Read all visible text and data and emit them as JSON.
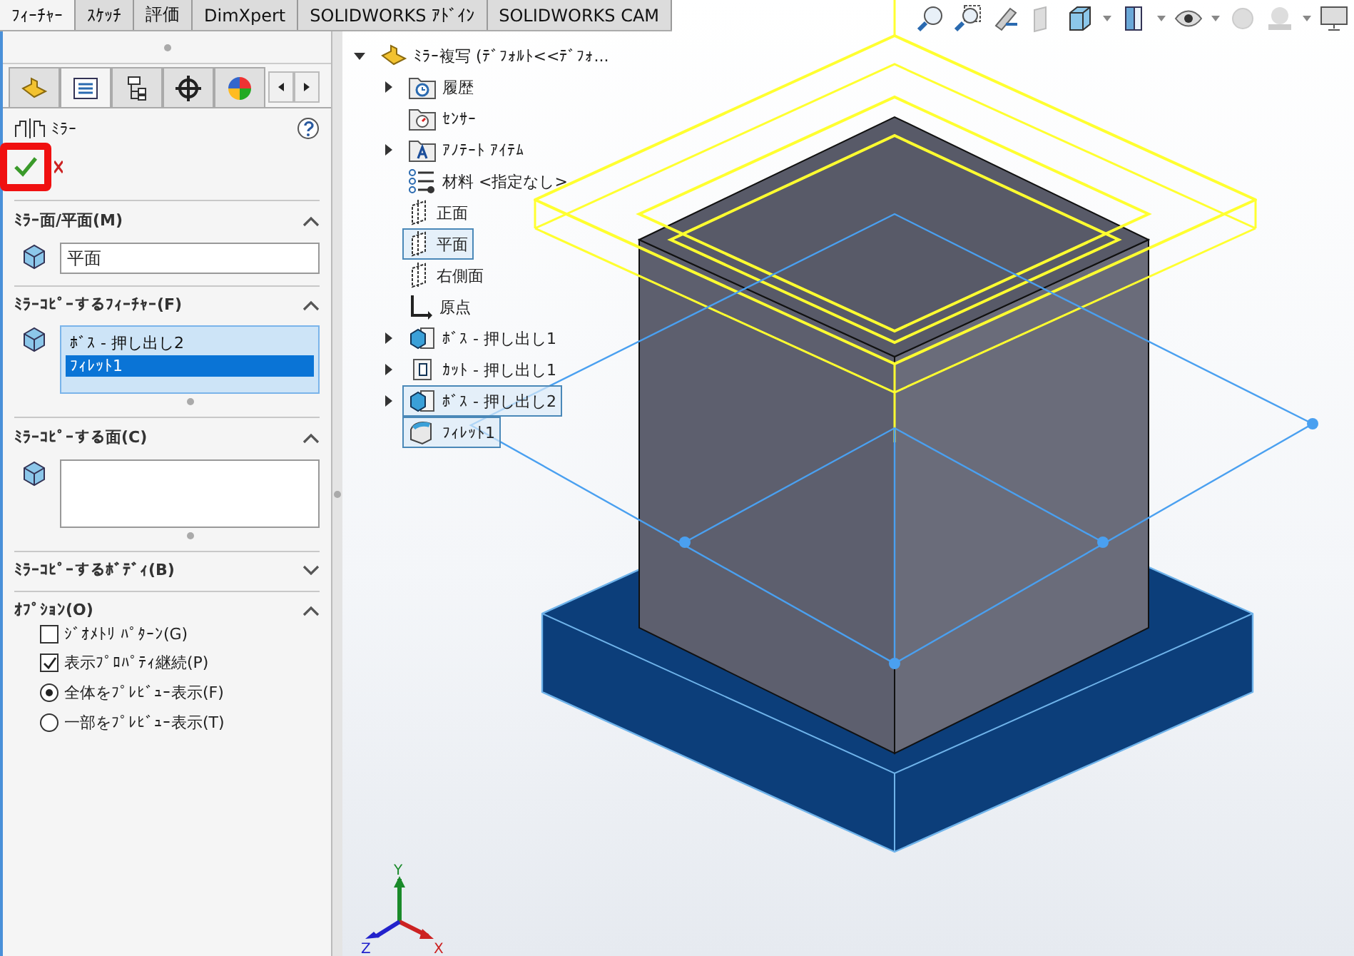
{
  "command_tabs": [
    {
      "label": "ﾌｨｰﾁｬｰ",
      "selected": true
    },
    {
      "label": "ｽｹｯﾁ",
      "selected": false
    },
    {
      "label": "評価",
      "selected": false
    },
    {
      "label": "DimXpert",
      "selected": false
    },
    {
      "label": "SOLIDWORKS ｱﾄﾞｲﾝ",
      "selected": false
    },
    {
      "label": "SOLIDWORKS CAM",
      "selected": false
    }
  ],
  "panel": {
    "tabs": [
      {
        "kind": "part",
        "selected": false
      },
      {
        "kind": "property",
        "selected": true
      },
      {
        "kind": "config",
        "selected": false
      },
      {
        "kind": "target",
        "selected": false
      },
      {
        "kind": "appearance",
        "selected": false
      }
    ],
    "title": "ﾐﾗｰ",
    "ok_highlighted": true,
    "sections": [
      {
        "kind": "field",
        "title": "ﾐﾗｰ面/平面(M)",
        "expanded": true,
        "value": "平面"
      },
      {
        "kind": "list",
        "title": "ﾐﾗｰｺﾋﾟｰするﾌｨｰﾁｬｰ(F)",
        "expanded": true,
        "items": [
          {
            "label": "ﾎﾞｽ - 押し出し2",
            "selected": false
          },
          {
            "label": "ﾌｨﾚｯﾄ1",
            "selected": true
          }
        ]
      },
      {
        "kind": "list",
        "title": "ﾐﾗｰｺﾋﾟｰする面(C)",
        "expanded": true
      },
      {
        "title": "ﾐﾗｰｺﾋﾟｰするﾎﾞﾃﾞｨ(B)",
        "expanded": false
      },
      {
        "kind": "options",
        "title": "ｵﾌﾟｼｮﾝ(O)",
        "expanded": true,
        "options": [
          {
            "kind": "checkbox",
            "label": "ｼﾞｵﾒﾄﾘ ﾊﾟﾀｰﾝ(G)",
            "checked": false
          },
          {
            "kind": "checkbox",
            "label": "表示ﾌﾟﾛﾊﾟﾃｨ継続(P)",
            "checked": true
          },
          {
            "kind": "radio",
            "label": "全体をﾌﾟﾚﾋﾞｭｰ表示(F)",
            "selected": true
          },
          {
            "kind": "radio",
            "label": "一部をﾌﾟﾚﾋﾞｭｰ表示(T)",
            "selected": false
          }
        ]
      }
    ]
  },
  "tree": {
    "label": "ﾐﾗｰ複写 (ﾃﾞﾌｫﾙﾄ<<ﾃﾞﾌｫ...",
    "expanded": true,
    "children": [
      {
        "kind": "folder-history",
        "label": "履歴",
        "expandable": true,
        "selected": false
      },
      {
        "kind": "folder-sensor",
        "label": "ｾﾝｻｰ",
        "expandable": false,
        "selected": false
      },
      {
        "kind": "folder-annotation",
        "label": "ｱﾉﾃｰﾄ ｱｲﾃﾑ",
        "expandable": true,
        "selected": false
      },
      {
        "kind": "material",
        "label": "材料 <指定なし>",
        "expandable": false,
        "selected": false
      },
      {
        "kind": "plane",
        "label": "正面",
        "expandable": false,
        "selected": false
      },
      {
        "kind": "plane",
        "label": "平面",
        "expandable": false,
        "selected": true
      },
      {
        "kind": "plane",
        "label": "右側面",
        "expandable": false,
        "selected": false
      },
      {
        "kind": "origin",
        "label": "原点",
        "expandable": false,
        "selected": false
      },
      {
        "kind": "boss",
        "label": "ﾎﾞｽ - 押し出し1",
        "expandable": true,
        "selected": false
      },
      {
        "kind": "cut",
        "label": "ｶｯﾄ - 押し出し1",
        "expandable": true,
        "selected": false
      },
      {
        "kind": "boss",
        "label": "ﾎﾞｽ - 押し出し2",
        "expandable": true,
        "selected": true
      },
      {
        "kind": "fillet",
        "label": "ﾌｨﾚｯﾄ1",
        "expandable": false,
        "selected": true
      }
    ]
  },
  "triad": {
    "x": "X",
    "y": "Y",
    "z": "Z"
  }
}
